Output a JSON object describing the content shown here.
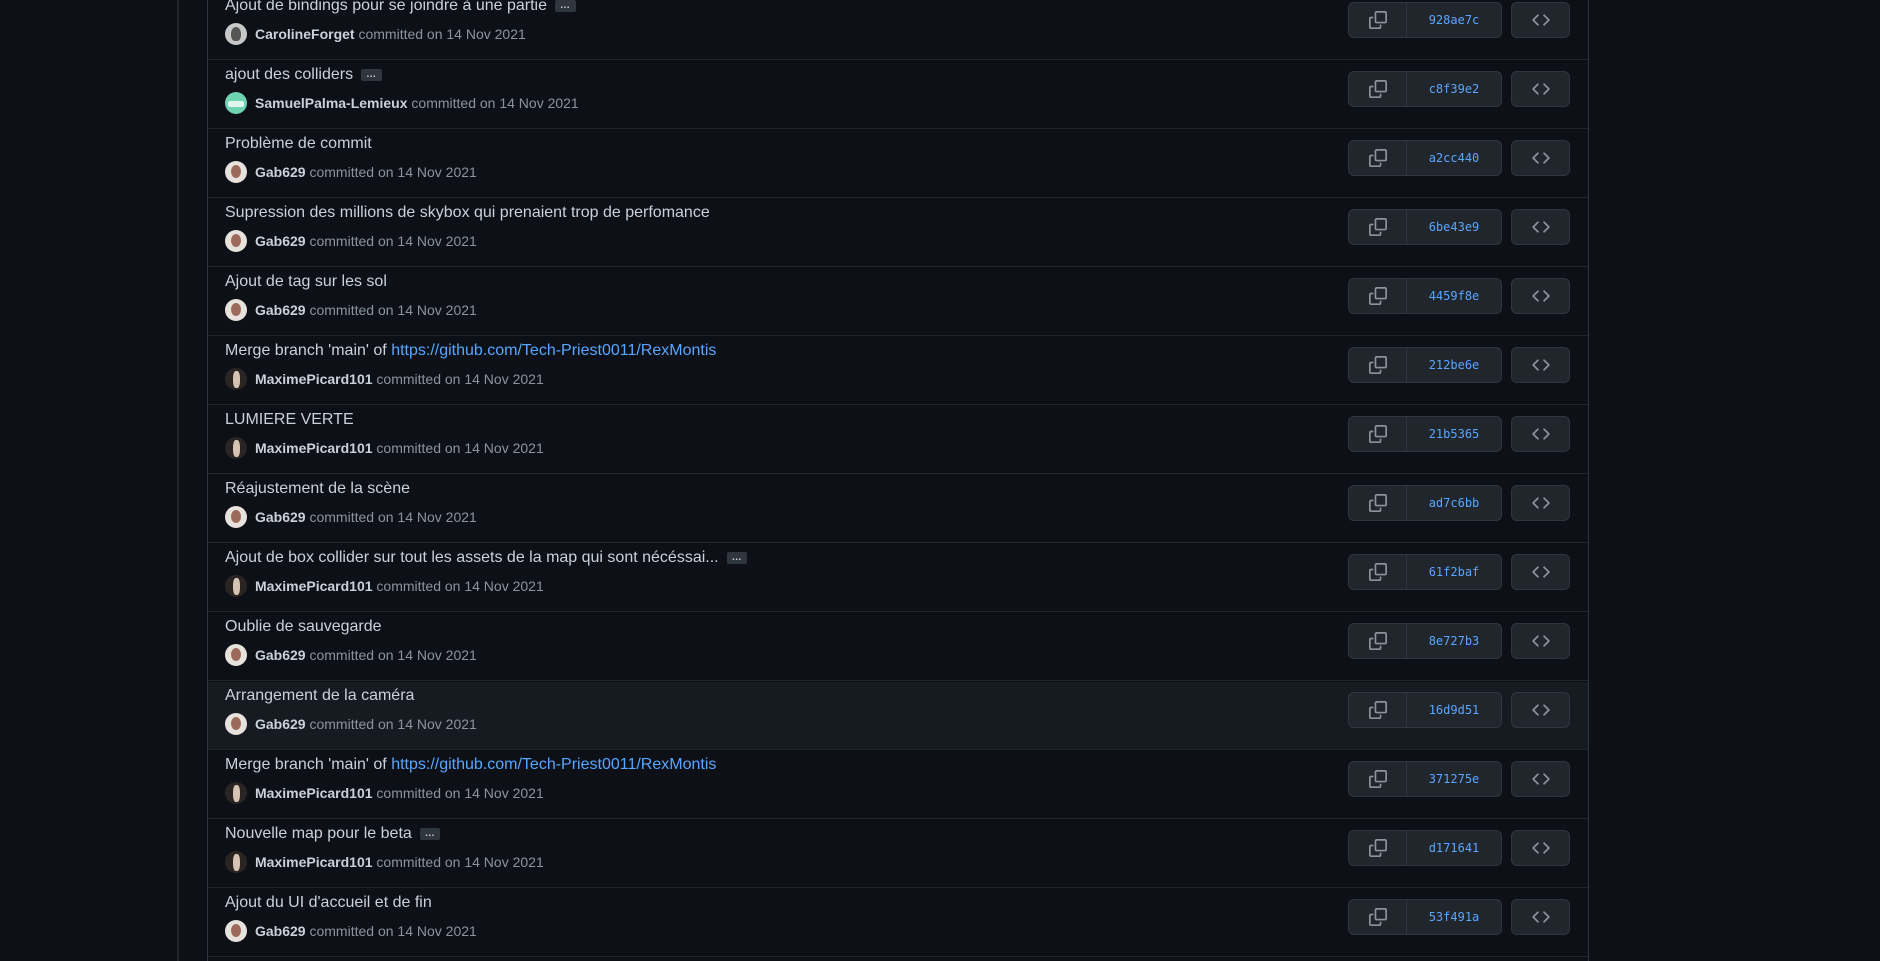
{
  "commits": [
    {
      "title": "Ajout de bindings pour se joindre à une partie",
      "has_ellipsis": true,
      "link": "",
      "author": "CarolineForget",
      "avatar": "caroline",
      "committed": "committed on 14 Nov 2021",
      "sha": "928ae7c"
    },
    {
      "title": "ajout des colliders",
      "has_ellipsis": true,
      "link": "",
      "author": "SamuelPalma-Lemieux",
      "avatar": "samuel",
      "committed": "committed on 14 Nov 2021",
      "sha": "c8f39e2"
    },
    {
      "title": "Problème de commit",
      "has_ellipsis": false,
      "link": "",
      "author": "Gab629",
      "avatar": "gab",
      "committed": "committed on 14 Nov 2021",
      "sha": "a2cc440"
    },
    {
      "title": "Supression des millions de skybox qui prenaient trop de perfomance",
      "has_ellipsis": false,
      "link": "",
      "author": "Gab629",
      "avatar": "gab",
      "committed": "committed on 14 Nov 2021",
      "sha": "6be43e9"
    },
    {
      "title": "Ajout de tag sur les sol",
      "has_ellipsis": false,
      "link": "",
      "author": "Gab629",
      "avatar": "gab",
      "committed": "committed on 14 Nov 2021",
      "sha": "4459f8e"
    },
    {
      "title": "Merge branch 'main' of ",
      "has_ellipsis": false,
      "link": "https://github.com/Tech-Priest0011/RexMontis",
      "author": "MaximePicard101",
      "avatar": "maxime",
      "committed": "committed on 14 Nov 2021",
      "sha": "212be6e"
    },
    {
      "title": "LUMIERE VERTE",
      "has_ellipsis": false,
      "link": "",
      "author": "MaximePicard101",
      "avatar": "maxime",
      "committed": "committed on 14 Nov 2021",
      "sha": "21b5365"
    },
    {
      "title": "Réajustement de la scène",
      "has_ellipsis": false,
      "link": "",
      "author": "Gab629",
      "avatar": "gab",
      "committed": "committed on 14 Nov 2021",
      "sha": "ad7c6bb"
    },
    {
      "title": "Ajout de box collider sur tout les assets de la map qui sont nécéssai...",
      "has_ellipsis": true,
      "link": "",
      "author": "MaximePicard101",
      "avatar": "maxime",
      "committed": "committed on 14 Nov 2021",
      "sha": "61f2baf"
    },
    {
      "title": "Oublie de sauvegarde",
      "has_ellipsis": false,
      "link": "",
      "author": "Gab629",
      "avatar": "gab",
      "committed": "committed on 14 Nov 2021",
      "sha": "8e727b3"
    },
    {
      "title": "Arrangement de la caméra",
      "has_ellipsis": false,
      "link": "",
      "author": "Gab629",
      "avatar": "gab",
      "committed": "committed on 14 Nov 2021",
      "sha": "16d9d51",
      "hover": true
    },
    {
      "title": "Merge branch 'main' of ",
      "has_ellipsis": false,
      "link": "https://github.com/Tech-Priest0011/RexMontis",
      "author": "MaximePicard101",
      "avatar": "maxime",
      "committed": "committed on 14 Nov 2021",
      "sha": "371275e"
    },
    {
      "title": "Nouvelle map pour le beta",
      "has_ellipsis": true,
      "link": "",
      "author": "MaximePicard101",
      "avatar": "maxime",
      "committed": "committed on 14 Nov 2021",
      "sha": "d171641"
    },
    {
      "title": "Ajout du UI d'accueil et de fin",
      "has_ellipsis": false,
      "link": "",
      "author": "Gab629",
      "avatar": "gab",
      "committed": "committed on 14 Nov 2021",
      "sha": "53f491a"
    }
  ],
  "ellipsis_label": "…",
  "icons": {
    "copy": "copy-icon",
    "browse": "code-icon"
  },
  "colors": {
    "background": "#0d1117",
    "link": "#58a6ff",
    "text": "#c9d1d9",
    "muted": "#8b949e",
    "button": "#21262d",
    "border": "#30363d"
  }
}
